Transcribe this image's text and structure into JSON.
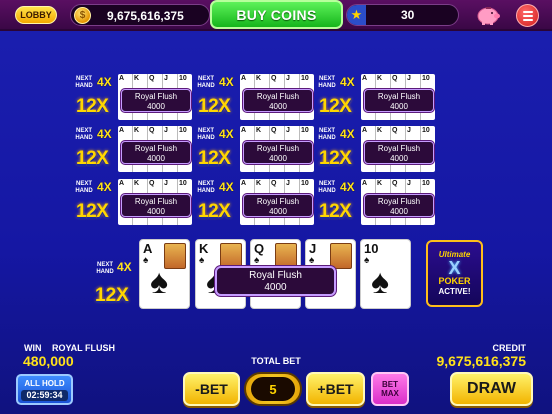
{
  "topbar": {
    "lobby_label": "LOBBY",
    "coins": "9,675,616,375",
    "coin_glyph": "$",
    "buy_coins_label": "BUY COINS",
    "level": "30"
  },
  "hand_labels": {
    "next_hand": "NEXT HAND",
    "mult_small": "4X",
    "mult_big": "12X",
    "mini_ranks": [
      "A",
      "K",
      "Q",
      "J",
      "10"
    ],
    "win_name": "Royal Flush",
    "win_amount": "4000"
  },
  "main_hand": {
    "cards": [
      {
        "rank": "A",
        "suit": "♠"
      },
      {
        "rank": "K",
        "suit": "♠"
      },
      {
        "rank": "Q",
        "suit": "♠"
      },
      {
        "rank": "J",
        "suit": "♠"
      },
      {
        "rank": "10",
        "suit": "♠"
      }
    ],
    "win_name": "Royal Flush",
    "win_amount": "4000"
  },
  "badge": {
    "line1": "Ultimate",
    "line2": "X",
    "line3": "POKER",
    "line4": "ACTIVE!"
  },
  "bottom": {
    "win_label": "WIN",
    "win_hand": "ROYAL FLUSH",
    "win_value": "480,000",
    "total_bet_label": "TOTAL BET",
    "credit_label": "CREDIT",
    "credit_value": "9,675,616,375",
    "all_hold_label": "ALL HOLD",
    "all_hold_timer": "02:59:34",
    "minus_bet_label": "-BET",
    "bet_value": "5",
    "plus_bet_label": "+BET",
    "bet_max_line1": "BET",
    "bet_max_line2": "MAX",
    "draw_label": "DRAW"
  },
  "colors": {
    "background": "#1517a3",
    "multiplier": "#ffd600",
    "win_box_border": "#c69cff",
    "buy_coins": "#15b51b"
  }
}
